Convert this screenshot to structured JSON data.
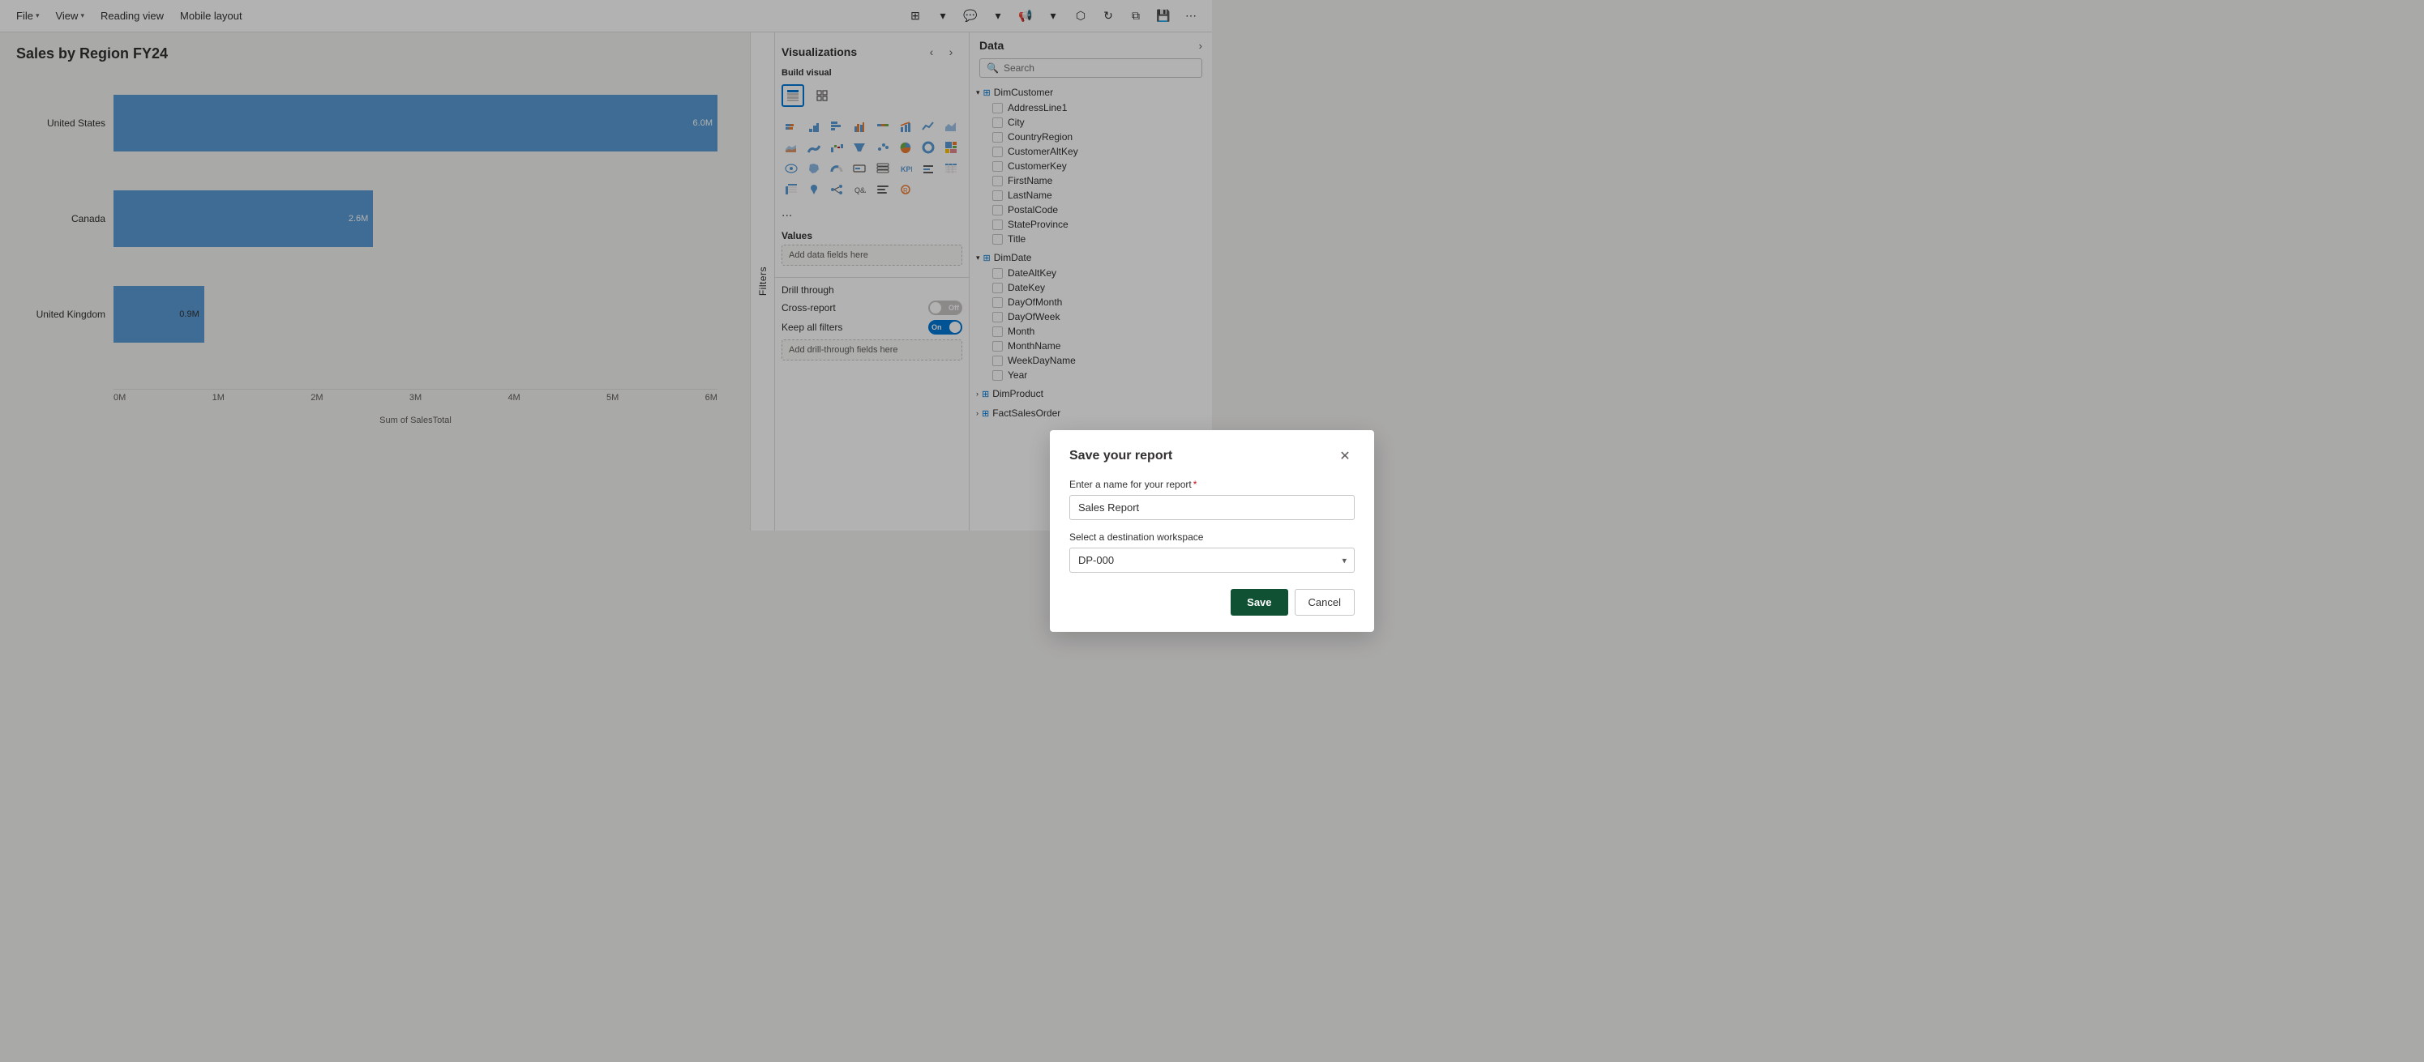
{
  "toolbar": {
    "file_label": "File",
    "view_label": "View",
    "reading_view_label": "Reading view",
    "mobile_layout_label": "Mobile layout"
  },
  "report": {
    "title": "Sales by Region FY24"
  },
  "chart": {
    "bars": [
      {
        "label": "United States",
        "value": "6.0M",
        "pct": 100
      },
      {
        "label": "Canada",
        "value": "2.6M",
        "pct": 43
      },
      {
        "label": "United Kingdom",
        "value": "0.9M",
        "pct": 15
      }
    ],
    "x_axis_labels": [
      "0M",
      "1M",
      "2M",
      "3M",
      "4M",
      "5M",
      "6M"
    ],
    "x_axis_field": "Sum of SalesTotal"
  },
  "filters": {
    "label": "Filters"
  },
  "visualizations": {
    "panel_title": "Visualizations",
    "build_visual_label": "Build visual",
    "more_label": "...",
    "values_label": "Values",
    "add_data_fields": "Add data fields here",
    "drill_through_label": "Drill through",
    "cross_report_label": "Cross-report",
    "keep_all_filters_label": "Keep all filters",
    "add_drill_fields": "Add drill-through fields here"
  },
  "data": {
    "panel_title": "Data",
    "search_placeholder": "Search",
    "tables": [
      {
        "name": "DimCustomer",
        "fields": [
          "AddressLine1",
          "City",
          "CountryRegion",
          "CustomerAltKey",
          "CustomerKey",
          "FirstName",
          "LastName",
          "PostalCode",
          "StateProvince",
          "Title"
        ]
      },
      {
        "name": "DimDate",
        "fields": [
          "DateAltKey",
          "DateKey",
          "DayOfMonth",
          "DayOfWeek",
          "Month",
          "MonthName",
          "WeekDayName",
          "Year"
        ]
      },
      {
        "name": "DimProduct",
        "fields": []
      },
      {
        "name": "FactSalesOrder",
        "fields": []
      }
    ]
  },
  "dialog": {
    "title": "Save your report",
    "name_label": "Enter a name for your report",
    "name_value": "Sales Report",
    "workspace_label": "Select a destination workspace",
    "workspace_value": "DP-000",
    "save_label": "Save",
    "cancel_label": "Cancel"
  }
}
